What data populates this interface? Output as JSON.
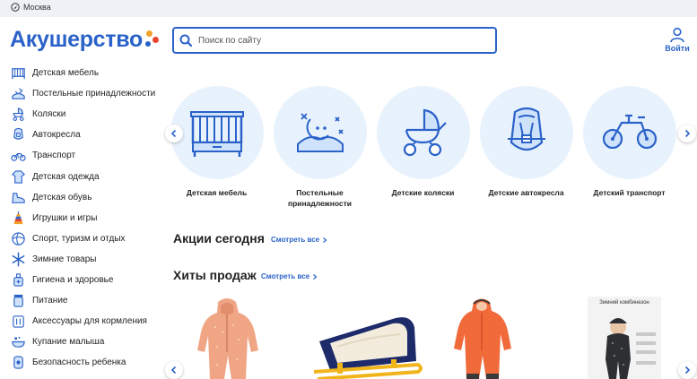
{
  "topbar": {
    "city": "Москва"
  },
  "header": {
    "logo_text": "Акушерство",
    "search_placeholder": "Поиск по сайту",
    "login_label": "Войти"
  },
  "colors": {
    "brand_blue": "#2a62c9",
    "light_blue": "#e8f2fd",
    "orange": "#f2a02a",
    "red": "#e8452c"
  },
  "sidebar": {
    "items": [
      {
        "label": "Детская мебель",
        "icon": "crib-icon"
      },
      {
        "label": "Постельные принадлежности",
        "icon": "bedding-icon"
      },
      {
        "label": "Коляски",
        "icon": "stroller-icon"
      },
      {
        "label": "Автокресла",
        "icon": "car-seat-icon"
      },
      {
        "label": "Транспорт",
        "icon": "bike-icon"
      },
      {
        "label": "Детская одежда",
        "icon": "clothes-icon"
      },
      {
        "label": "Детская обувь",
        "icon": "shoe-icon"
      },
      {
        "label": "Игрушки и игры",
        "icon": "toy-icon"
      },
      {
        "label": "Спорт, туризм и отдых",
        "icon": "ball-icon"
      },
      {
        "label": "Зимние товары",
        "icon": "snowflake-icon"
      },
      {
        "label": "Гигиена и здоровье",
        "icon": "hygiene-icon"
      },
      {
        "label": "Питание",
        "icon": "food-jar-icon"
      },
      {
        "label": "Аксессуары для кормления",
        "icon": "feeding-icon"
      },
      {
        "label": "Купание малыша",
        "icon": "bath-icon"
      },
      {
        "label": "Безопасность ребенка",
        "icon": "safety-icon"
      }
    ]
  },
  "categories": [
    {
      "label": "Детская мебель",
      "icon": "crib-icon"
    },
    {
      "label": "Постельные принадлежности",
      "icon": "bedding-icon"
    },
    {
      "label": "Детские коляски",
      "icon": "stroller-icon"
    },
    {
      "label": "Детские автокресла",
      "icon": "car-seat-icon"
    },
    {
      "label": "Детский транспорт",
      "icon": "tricycle-icon"
    }
  ],
  "sections": {
    "promo": {
      "title": "Акции сегодня",
      "link": "Смотреть все"
    },
    "hits": {
      "title": "Хиты продаж",
      "link": "Смотреть все"
    }
  },
  "products": [
    {
      "image": "peach-snowsuit-image"
    },
    {
      "image": "blue-sled-image"
    },
    {
      "image": "orange-snowsuit-image"
    },
    {
      "image": "dark-winter-overall-image",
      "caption": "Зимний комбинезон"
    }
  ]
}
